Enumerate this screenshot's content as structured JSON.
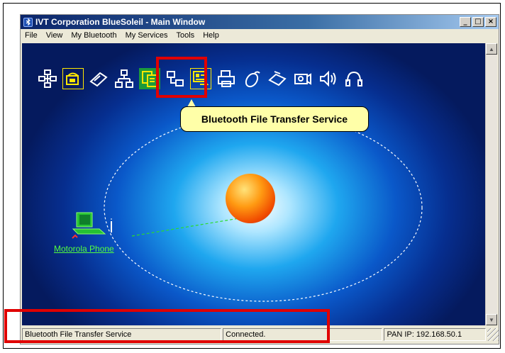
{
  "window": {
    "title": "IVT Corporation BlueSoleil - Main Window"
  },
  "title_buttons": [
    "_",
    "□",
    "×"
  ],
  "menu": [
    "File",
    "View",
    "My Bluetooth",
    "My Services",
    "Tools",
    "Help"
  ],
  "service_icons": [
    "network-icon",
    "phone-dialup-icon",
    "fax-modem-icon",
    "lan-access-icon",
    "file-transfer-icon",
    "pan-icon",
    "object-push-icon",
    "printer-icon",
    "mouse-icon",
    "fax-icon",
    "camera-icon",
    "audio-icon",
    "headset-icon"
  ],
  "tooltip": {
    "text": "Bluetooth File Transfer Service"
  },
  "device": {
    "name": "Motorola Phone"
  },
  "status": {
    "left": "Bluetooth File Transfer Service",
    "middle": "Connected.",
    "right": "PAN IP: 192.168.50.1"
  },
  "colors": {
    "highlight": "#e00000",
    "tooltip": "#ffffa8",
    "device_label": "#54ff3e",
    "service_icon": "#ffe800"
  }
}
